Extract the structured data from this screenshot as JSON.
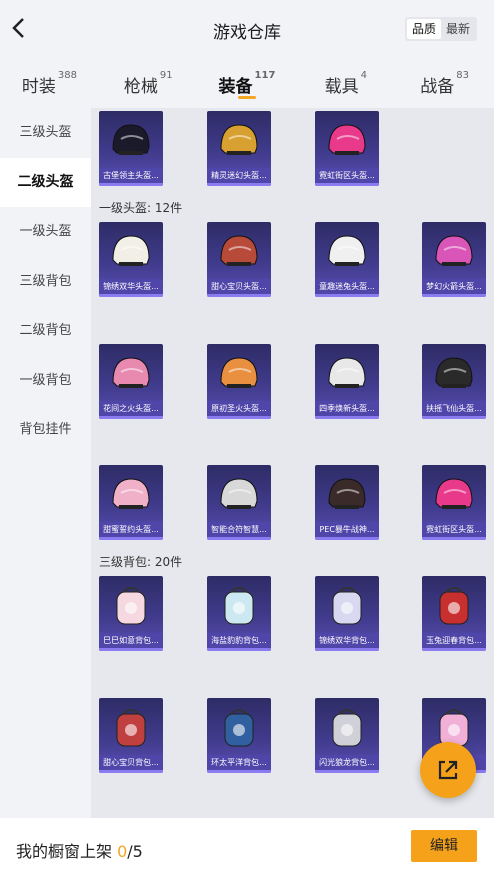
{
  "header": {
    "title": "游戏仓库",
    "sort_quality": "品质",
    "sort_latest": "最新"
  },
  "tabs": [
    {
      "label": "时装",
      "count": "388"
    },
    {
      "label": "枪械",
      "count": "91"
    },
    {
      "label": "装备",
      "count": "117"
    },
    {
      "label": "载具",
      "count": "4"
    },
    {
      "label": "战备",
      "count": "83"
    }
  ],
  "sidebar": [
    "三级头盔",
    "二级头盔",
    "一级头盔",
    "三级背包",
    "二级背包",
    "一级背包",
    "背包挂件"
  ],
  "sections": {
    "helmet1": "一级头盔: 12件",
    "backpack3": "三级背包: 20件"
  },
  "items": {
    "row0": [
      "古堡领主头盔...",
      "精灵迷幻头盔...",
      "霓虹街区头盔..."
    ],
    "row1": [
      "锦绣双华头盔...",
      "甜心宝贝头盔...",
      "童趣迷兔头盔...",
      "梦幻火箭头盔..."
    ],
    "row2": [
      "花间之火头盔...",
      "原初圣火头盔...",
      "四季焕新头盔...",
      "扶摇飞仙头盔..."
    ],
    "row3": [
      "甜蜜誓约头盔...",
      "智能合符智慧...",
      "PEC暴牛战神...",
      "霓虹街区头盔..."
    ],
    "row4": [
      "巳巳如意背包...",
      "海盐豹豹背包...",
      "锦绣双华背包...",
      "玉兔迎春背包..."
    ],
    "row5": [
      "甜心宝贝背包...",
      "环太平洋背包...",
      "闪光狼龙背包...",
      ""
    ]
  },
  "bottom": {
    "shelf_label": "我的橱窗上架 ",
    "shelf_count": "0",
    "shelf_total": "/5",
    "edit_label": "编辑"
  },
  "colors": {
    "accent": "#f5a21a",
    "card_bg": "#403b8c",
    "caption_bg": "#5046aa"
  }
}
